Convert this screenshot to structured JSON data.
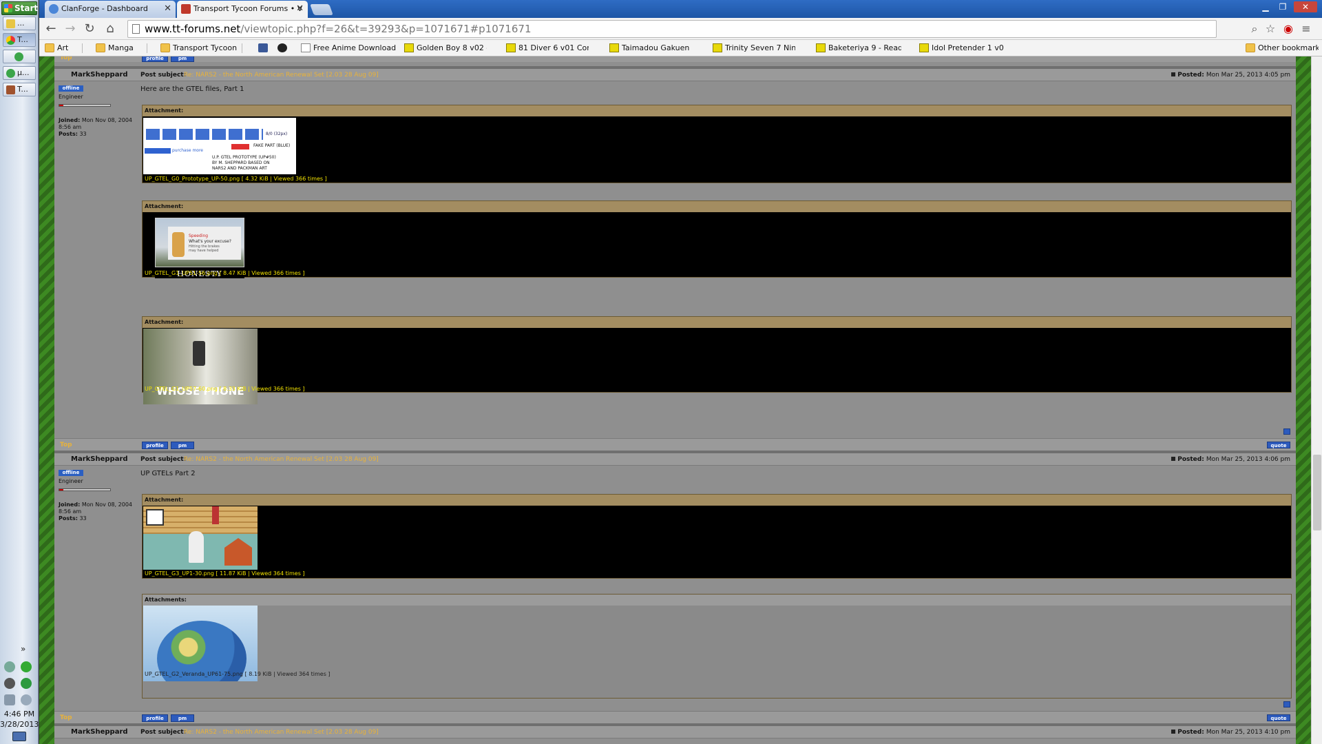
{
  "taskbar": {
    "start_label": "Start",
    "tasks": [
      {
        "label": "...",
        "icon_color": "#e7c544"
      },
      {
        "label": "T...",
        "icon_color": "#4a8ad8"
      },
      {
        "label": "",
        "icon_color": "#3ca54a"
      },
      {
        "label": "µ...",
        "icon_color": "#3ca54a"
      },
      {
        "label": "T...",
        "icon_color": "#a0522d"
      }
    ],
    "tray_expand": "»",
    "time": "4:46 PM",
    "date": "3/28/2013"
  },
  "browser": {
    "tabs": [
      {
        "title": "ClanForge - Dashboard",
        "icon": "clanforge-icon"
      },
      {
        "title": "Transport Tycoon Forums • V",
        "icon": "tt-forums-icon"
      }
    ],
    "close_glyph": "✕",
    "url_host": "www.tt-forums.net",
    "url_path": "/viewtopic.php?f=26&t=39293&p=1071671#p1071671",
    "bookmarks": [
      {
        "label": "Art",
        "icon": "folder-icon"
      },
      {
        "label": "Manga",
        "icon": "folder-icon"
      },
      {
        "label": "Transport Tycoon",
        "icon": "folder-icon"
      },
      {
        "label": "",
        "icon": "facebook-icon"
      },
      {
        "label": "",
        "icon": "steam-icon"
      },
      {
        "label": "Free Anime Download ...",
        "icon": "page-icon"
      },
      {
        "label": "Golden Boy 8 v02 - Re...",
        "icon": "manga-icon"
      },
      {
        "label": "81 Diver 6 v01 Comme...",
        "icon": "manga-icon"
      },
      {
        "label": "Taimadou Gakuen 35 ...",
        "icon": "manga-icon"
      },
      {
        "label": "Trinity Seven 7 Nin no ...",
        "icon": "manga-icon"
      },
      {
        "label": "Baketeriya 9 - Read B...",
        "icon": "manga-icon"
      },
      {
        "label": "Idol Pretender 1 v01 - ...",
        "icon": "manga-icon"
      }
    ],
    "other_bookmarks": "Other bookmarks"
  },
  "forum": {
    "top_link": "Top",
    "profile_label": "profile",
    "pm_label": "pm",
    "quote_label": "quote",
    "subject_label": "Post subject:",
    "posted_label": "Posted:",
    "attachment_label": "Attachment:",
    "attachments_label": "Attachments:",
    "posts": [
      {
        "author": "MarkSheppard",
        "status": "offline",
        "rank": "Engineer",
        "joined_label": "Joined:",
        "joined": "Mon Nov 08, 2004 8:56 am",
        "posts_label": "Posts:",
        "posts_count": "33",
        "subject": "Re: NARS2 - the North American Renewal Set [2.03 28 Aug 09]",
        "posted": "Mon Mar 25, 2013 4:05 pm",
        "body": "Here are the GTEL files, Part 1",
        "attachments": [
          {
            "caption": "UP_GTEL_G0_Prototype_UP-50.png [ 4.32 KiB | Viewed 366 times ]",
            "lines": [
              "purchase more",
              "FAKE PART (BLUE)",
              "U.P. GTEL PROTOTYPE (UP#50)",
              "BY M. SHEPPARD BASED ON",
              "NARS2 AND PACKMAN ART"
            ],
            "tag": "8/0 (32px)"
          },
          {
            "caption": "UP_GTEL_G1_UP51-56.png [ 8.47 KiB | Viewed 366 times ]",
            "sign_text": [
              "Speeding",
              "What's your excuse?",
              "Hitting the brakes",
              "may have helped"
            ],
            "overlay": "HONESTY"
          },
          {
            "caption": "UP_GTEL_G1_UP57-60.png [ 8.33 KiB | Viewed 366 times ]",
            "overlay": "WHOSE PHONE"
          }
        ]
      },
      {
        "author": "MarkSheppard",
        "status": "offline",
        "rank": "Engineer",
        "joined_label": "Joined:",
        "joined": "Mon Nov 08, 2004 8:56 am",
        "posts_label": "Posts:",
        "posts_count": "33",
        "subject": "Re: NARS2 - the North American Renewal Set [2.03 28 Aug 09]",
        "posted": "Mon Mar 25, 2013 4:06 pm",
        "body": "UP GTELs Part 2",
        "attachments": [
          {
            "caption": "UP_GTEL_G3_UP1-30.png [ 11.87 KiB | Viewed 364 times ]"
          },
          {
            "caption": "UP_GTEL_G2_Veranda_UP61-75.png [ 8.19 KiB | Viewed 364 times ]"
          }
        ]
      },
      {
        "author": "MarkSheppard",
        "subject": "Re: NARS2 - the North American Renewal Set [2.03 28 Aug 09]",
        "posted": "Mon Mar 25, 2013 4:10 pm"
      }
    ]
  }
}
